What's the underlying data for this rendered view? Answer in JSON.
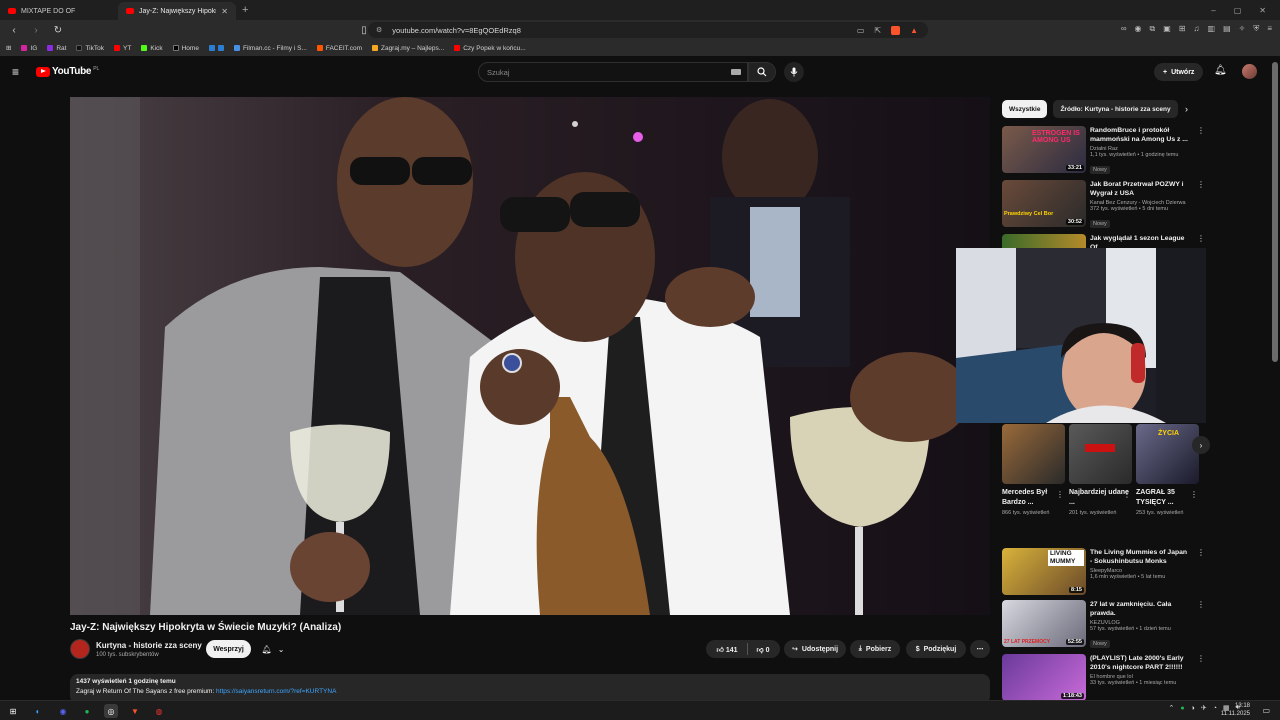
{
  "browser": {
    "tabs": [
      {
        "title": "MIXTAPE DO OF"
      },
      {
        "title": "Jay-Z: Największy Hipokryta"
      }
    ],
    "url": "youtube.com/watch?v=8EgQOEdRzq8",
    "bookmarks": [
      "IG",
      "Rat",
      "TikTok",
      "YT",
      "Kick",
      "Home",
      "Filman.cc - Filmy i S...",
      "FACEIT.com",
      "Zagraj.my – Najleps...",
      "Czy Popek w końcu..."
    ]
  },
  "youtube": {
    "logo_text": "YouTube",
    "logo_country": "PL",
    "search_placeholder": "Szukaj",
    "create_label": "Utwórz"
  },
  "video": {
    "title": "Jay-Z: Największy Hipokryta w Świecie Muzyki? (Analiza)",
    "channel_name": "Kurtyna - historie zza sceny",
    "subscribers": "100 tys. subskrybentów",
    "support_label": "Wesprzyj",
    "likes": "141",
    "dislikes": "0",
    "share_label": "Udostępnij",
    "download_label": "Pobierz",
    "thanks_label": "Podziękuj",
    "views_and_time": "1437 wyświetleń  1 godzinę temu",
    "description_prefix": "Zagraj w Return Of The Sayans z free premium: ",
    "description_link": "https://saiyansreturn.com/?ref=KURTYNA"
  },
  "sidebar": {
    "chips": [
      "Wszystkie",
      "Źródło: Kurtyna - historie zza sceny"
    ],
    "recommendations": [
      {
        "title": "RandomBruce i protokół mammoński na Among Us z ...",
        "channel": "Dzialni Raz",
        "meta": "1,1 tys. wyświetleń • 1 godzinę temu",
        "badge": "Nowy",
        "duration": "33:21",
        "thumb_text": "ESTROGEN IS AMONG US"
      },
      {
        "title": "Jak Borat Przetrwał POZWY i Wygrał z USA",
        "channel": "Kanał Bez Cenzury - Wojciech Dzierwa",
        "meta": "372 tys. wyświetleń • 5 dni temu",
        "badge": "Nowy",
        "duration": "30:52",
        "thumb_text": "Prawdziwy Cel Bor"
      },
      {
        "title": "Jak wyglądał 1 sezon League Of",
        "channel": "",
        "meta": "",
        "badge": "",
        "duration": "",
        "thumb_text": ""
      },
      {
        "title": "The Living Mummies of Japan - Sokushinbutsu Monks",
        "channel": "SleepyMarco",
        "meta": "1,6 mln wyświetleń • 5 lat temu",
        "badge": "",
        "duration": "8:15",
        "thumb_text": "LIVING MUMMY"
      },
      {
        "title": "27 lat w zamknięciu. Cała prawda.",
        "channel": "KEZUVLOG",
        "meta": "57 tys. wyświetleń • 1 dzień temu",
        "badge": "Nowy",
        "duration": "52:55",
        "thumb_text": "27 LAT PRZEMOCY"
      },
      {
        "title": "(PLAYLIST) Late 2000's Early 2010's nightcore PART 2!!!!!!",
        "channel": "El hombre que lol",
        "meta": "33 tys. wyświetleń • 1 miesiąc temu",
        "badge": "",
        "duration": "1:18:43",
        "thumb_text": ""
      }
    ],
    "shorts": [
      {
        "title": "Mercedes Był Bardzo ...",
        "views": "866 tys. wyświetleń"
      },
      {
        "title": "Najbardziej udane ...",
        "views": "201 tys. wyświetleń"
      },
      {
        "title": "ZAGRAŁ 35 TYSIĘCY ...",
        "views": "253 tys. wyświetleń",
        "thumb_text": "ŻYCIA"
      }
    ]
  },
  "taskbar": {
    "time": "13:18",
    "date": "11.11.2025"
  },
  "colors": {
    "background": "#0f0f0f",
    "accent_red": "#ff0000",
    "link_blue": "#3ea6ff",
    "pill_bg": "#272727"
  }
}
